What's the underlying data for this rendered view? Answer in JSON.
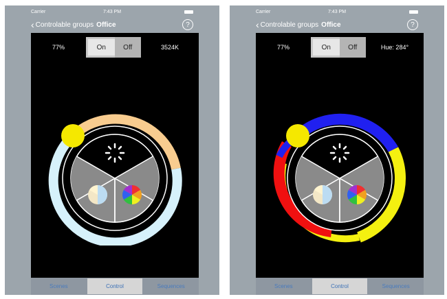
{
  "screens": [
    {
      "status": {
        "carrier": "Carrier",
        "time": "7:43 PM"
      },
      "nav": {
        "back_label": "Controlable groups",
        "title": "Office",
        "help_label": "?"
      },
      "controls": {
        "brightness": "77%",
        "on_label": "On",
        "off_label": "Off",
        "readout": "3524K",
        "power": "On"
      },
      "wheel": {
        "mode": "color-temperature",
        "ring_colors": [
          "#f8cc8f",
          "#d6f1fb"
        ]
      },
      "tabs": [
        {
          "label": "Scenes",
          "active": false
        },
        {
          "label": "Control",
          "active": true
        },
        {
          "label": "Sequences",
          "active": false
        }
      ]
    },
    {
      "status": {
        "carrier": "Carrier",
        "time": "7:43 PM"
      },
      "nav": {
        "back_label": "Controlable groups",
        "title": "Office",
        "help_label": "?"
      },
      "controls": {
        "brightness": "77%",
        "on_label": "On",
        "off_label": "Off",
        "readout": "Hue: 284°",
        "power": "On"
      },
      "wheel": {
        "mode": "hue",
        "ring_colors": [
          "#2020f0",
          "#f4f010",
          "#f01010"
        ]
      },
      "tabs": [
        {
          "label": "Scenes",
          "active": false
        },
        {
          "label": "Control",
          "active": true
        },
        {
          "label": "Sequences",
          "active": false
        }
      ]
    }
  ],
  "colors": {
    "knob": "#f5e800",
    "background": "#000000",
    "segment_gray": "#8a8a8a"
  },
  "icons": [
    "chevron-left-icon",
    "help-icon",
    "sun-icon",
    "white-balance-icon",
    "color-wheel-icon"
  ]
}
